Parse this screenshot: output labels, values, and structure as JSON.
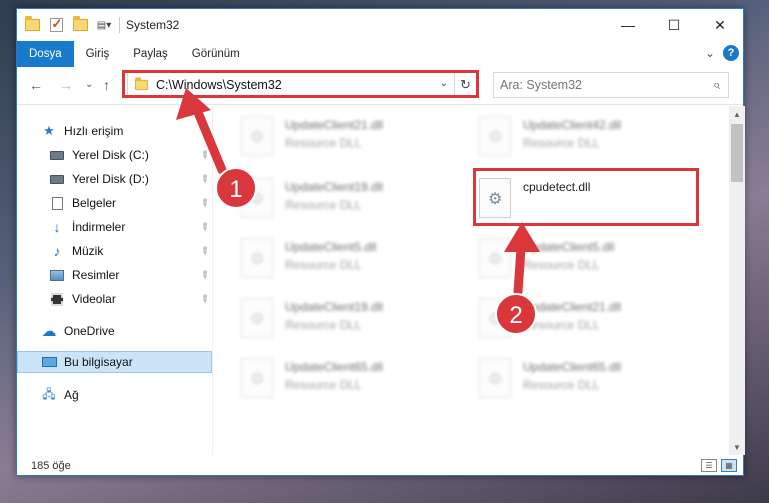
{
  "titlebar": {
    "title": "System32",
    "controls": {
      "minimize": "—",
      "maximize": "☐",
      "close": "✕"
    }
  },
  "ribbon": {
    "tabs": [
      "Dosya",
      "Giriş",
      "Paylaş",
      "Görünüm"
    ],
    "active_tab": "Dosya",
    "expand_glyph": "⌄",
    "help_glyph": "?"
  },
  "nav": {
    "back": "←",
    "forward": "→",
    "recent": "⌄",
    "up": "↑"
  },
  "address": {
    "path": "C:\\Windows\\System32",
    "dropdown": "⌄",
    "refresh": "↻"
  },
  "search": {
    "placeholder": "Ara: System32",
    "icon": "⌕"
  },
  "sidebar": {
    "items": [
      {
        "label": "Hızlı erişim",
        "icon": "star-icon"
      },
      {
        "label": "Yerel Disk (C:)",
        "icon": "drive-icon",
        "pinned": true
      },
      {
        "label": "Yerel Disk (D:)",
        "icon": "drive-icon",
        "pinned": true
      },
      {
        "label": "Belgeler",
        "icon": "document-icon",
        "pinned": true
      },
      {
        "label": "İndirmeler",
        "icon": "download-icon",
        "pinned": true
      },
      {
        "label": "Müzik",
        "icon": "music-icon",
        "pinned": true
      },
      {
        "label": "Resimler",
        "icon": "pictures-icon",
        "pinned": true
      },
      {
        "label": "Videolar",
        "icon": "videos-icon",
        "pinned": true
      },
      {
        "label": "OneDrive",
        "icon": "cloud-icon"
      },
      {
        "label": "Bu bilgisayar",
        "icon": "computer-icon",
        "selected": true
      },
      {
        "label": "Ağ",
        "icon": "network-icon"
      }
    ],
    "pin_glyph": "📌"
  },
  "files": {
    "left_column": [
      {
        "name": "UpdateClient21.dll",
        "type": "Resource DLL"
      },
      {
        "name": "UpdateClient19.dll",
        "type": "Resource DLL"
      },
      {
        "name": "UpdateClient5.dll",
        "type": "Resource DLL"
      },
      {
        "name": "UpdateClient19.dll",
        "type": "Resource DLL"
      },
      {
        "name": "UpdateClient65.dll",
        "type": "Resource DLL"
      }
    ],
    "right_column": [
      {
        "name": "UpdateClient42.dll",
        "type": "Resource DLL"
      },
      {
        "name": "cpudetect.dll",
        "type": ""
      },
      {
        "name": "UpdateClient5.dll",
        "type": "Resource DLL"
      },
      {
        "name": "UpdateClient21.dll",
        "type": "Resource DLL"
      },
      {
        "name": "UpdateClient65.dll",
        "type": "Resource DLL"
      }
    ]
  },
  "status": {
    "item_count": "185 öğe"
  },
  "annotations": {
    "step1": "1",
    "step2": "2",
    "color": "#d9373b"
  }
}
